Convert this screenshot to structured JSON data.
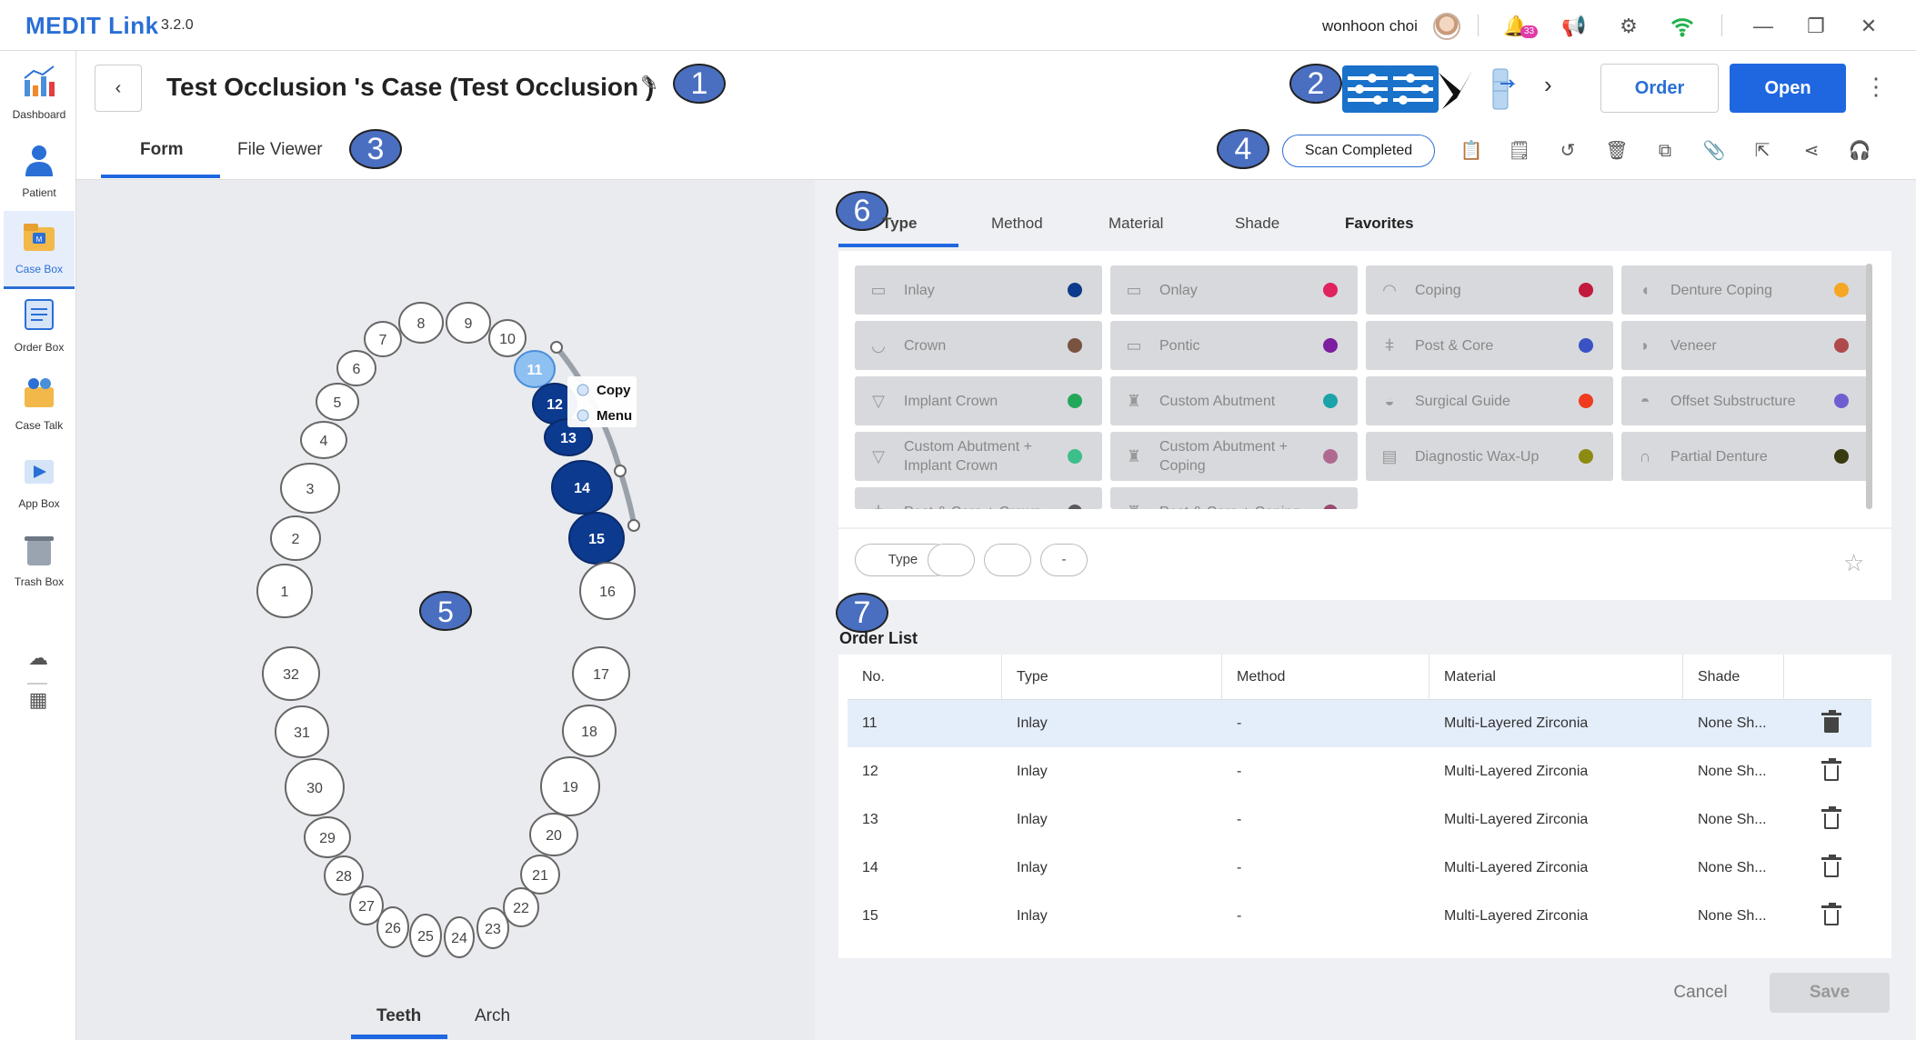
{
  "app": {
    "name": "MEDIT Link",
    "version": "3.2.0",
    "user": "wonhoon choi",
    "notification_count": "33"
  },
  "sidebar": {
    "items": [
      {
        "label": "Dashboard",
        "icon": "dashboard-chart-icon"
      },
      {
        "label": "Patient",
        "icon": "patient-icon"
      },
      {
        "label": "Case Box",
        "icon": "case-box-icon"
      },
      {
        "label": "Order Box",
        "icon": "order-box-icon"
      },
      {
        "label": "Case Talk",
        "icon": "case-talk-icon"
      },
      {
        "label": "App Box",
        "icon": "app-box-icon"
      },
      {
        "label": "Trash Box",
        "icon": "trash-box-icon"
      }
    ]
  },
  "header": {
    "title": "Test Occlusion 's Case (Test Occlusion )",
    "order_label": "Order",
    "open_label": "Open",
    "tabs": [
      "Form",
      "File Viewer"
    ],
    "status": "Scan Completed"
  },
  "markers": [
    "1",
    "2",
    "3",
    "4",
    "5",
    "6",
    "7"
  ],
  "teeth_chart": {
    "selected": [
      11,
      12,
      13,
      14,
      15
    ],
    "context_menu": [
      "Copy",
      "Menu"
    ],
    "view_tabs": [
      "Teeth",
      "Arch"
    ]
  },
  "type_tabs": [
    "Type",
    "Method",
    "Material",
    "Shade",
    "Favorites"
  ],
  "types": [
    {
      "label": "Inlay",
      "color": "#0d3a8c"
    },
    {
      "label": "Onlay",
      "color": "#e0225f"
    },
    {
      "label": "Coping",
      "color": "#c21a3c"
    },
    {
      "label": "Denture Coping",
      "color": "#f5a623"
    },
    {
      "label": "Crown",
      "color": "#7a5240"
    },
    {
      "label": "Pontic",
      "color": "#7d1da0"
    },
    {
      "label": "Post & Core",
      "color": "#3a52c4"
    },
    {
      "label": "Veneer",
      "color": "#b04a4a"
    },
    {
      "label": "Implant Crown",
      "color": "#23a85a"
    },
    {
      "label": "Custom Abutment",
      "color": "#1aa3a8"
    },
    {
      "label": "Surgical Guide",
      "color": "#f03c1e"
    },
    {
      "label": "Offset Substructure",
      "color": "#6e5fd0"
    },
    {
      "label": "Custom Abutment + Implant Crown",
      "color": "#3dbf8c"
    },
    {
      "label": "Custom Abutment + Coping",
      "color": "#b06a90"
    },
    {
      "label": "Diagnostic Wax-Up",
      "color": "#8c8a10"
    },
    {
      "label": "Partial Denture",
      "color": "#3a3a10"
    },
    {
      "label": "Post & Core + Crown",
      "color": "#5a5a5a"
    },
    {
      "label": "Post & Core + Coping",
      "color": "#9a4a70"
    }
  ],
  "chips": [
    "Type",
    "",
    "",
    "-"
  ],
  "order_list": {
    "label": "Order List",
    "columns": [
      "No.",
      "Type",
      "Method",
      "Material",
      "Shade"
    ],
    "rows": [
      {
        "no": "11",
        "type": "Inlay",
        "method": "-",
        "material": "Multi-Layered Zirconia",
        "shade": "None Sh..."
      },
      {
        "no": "12",
        "type": "Inlay",
        "method": "-",
        "material": "Multi-Layered Zirconia",
        "shade": "None Sh..."
      },
      {
        "no": "13",
        "type": "Inlay",
        "method": "-",
        "material": "Multi-Layered Zirconia",
        "shade": "None Sh..."
      },
      {
        "no": "14",
        "type": "Inlay",
        "method": "-",
        "material": "Multi-Layered Zirconia",
        "shade": "None Sh..."
      },
      {
        "no": "15",
        "type": "Inlay",
        "method": "-",
        "material": "Multi-Layered Zirconia",
        "shade": "None Sh..."
      }
    ]
  },
  "footer": {
    "cancel": "Cancel",
    "save": "Save"
  }
}
